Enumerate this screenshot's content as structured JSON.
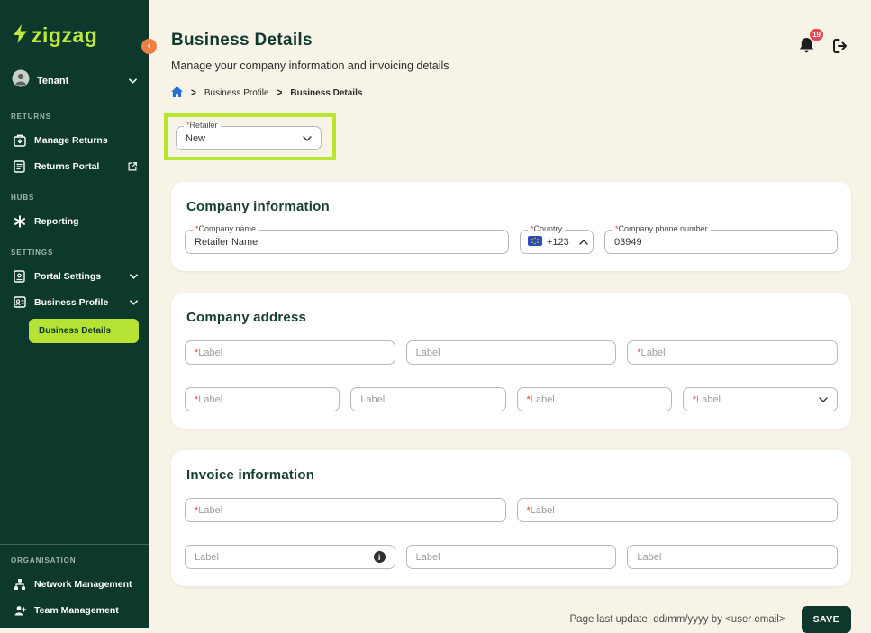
{
  "colors": {
    "sidebar_bg": "#0c392b",
    "brand_lime": "#bfe93c",
    "active_pill": "#b5e235",
    "page_bg": "#f7f3e7",
    "highlight_border": "#b8e52e",
    "badge_red": "#e5484d",
    "accent_orange": "#ee8042",
    "save_bg": "#0c392b",
    "breadcrumb_home_blue": "#2b6bd9"
  },
  "sidebar": {
    "logo": "zigzag",
    "tenant": {
      "label": "Tenant"
    },
    "sections": [
      {
        "title": "RETURNS",
        "items": [
          {
            "label": "Manage Returns"
          },
          {
            "label": "Returns Portal"
          }
        ]
      },
      {
        "title": "HUBS",
        "items": [
          {
            "label": "Reporting"
          }
        ]
      },
      {
        "title": "SETTINGS",
        "items": [
          {
            "label": "Portal Settings"
          },
          {
            "label": "Business Profile"
          }
        ]
      }
    ],
    "active_item": "Business Details",
    "org": {
      "title": "ORGANISATION",
      "items": [
        {
          "label": "Network Management"
        },
        {
          "label": "Team Management"
        }
      ]
    }
  },
  "header": {
    "title": "Business Details",
    "subtitle": "Manage your company information and invoicing details",
    "breadcrumb": {
      "parent": "Business Profile",
      "current": "Business Details"
    },
    "notification_count": "19"
  },
  "retailer": {
    "required": "*",
    "label": "Retailer",
    "value": "New"
  },
  "company_information": {
    "title": "Company information",
    "name": {
      "required": "*",
      "label": "Company name",
      "value": "Retailer Name"
    },
    "country": {
      "required": "*",
      "label": "Country",
      "value": "+123"
    },
    "phone": {
      "required": "*",
      "label": "Company phone number",
      "value": "03949"
    }
  },
  "company_address": {
    "title": "Company address",
    "row1": [
      {
        "required": "*",
        "label": "Label"
      },
      {
        "required": "",
        "label": "Label"
      },
      {
        "required": "*",
        "label": "Label"
      }
    ],
    "row2": [
      {
        "required": "*",
        "label": "Label"
      },
      {
        "required": "",
        "label": "Label"
      },
      {
        "required": "*",
        "label": "Label"
      },
      {
        "required": "*",
        "label": "Label"
      }
    ]
  },
  "invoice_information": {
    "title": "Invoice information",
    "row1": [
      {
        "required": "*",
        "label": "Label"
      },
      {
        "required": "*",
        "label": "Label"
      }
    ],
    "row2": [
      {
        "required": "",
        "label": "Label"
      },
      {
        "required": "",
        "label": "Label"
      },
      {
        "required": "",
        "label": "Label"
      }
    ]
  },
  "footer": {
    "last_update": "Page last update: dd/mm/yyyy by <user email>",
    "save": "SAVE"
  }
}
